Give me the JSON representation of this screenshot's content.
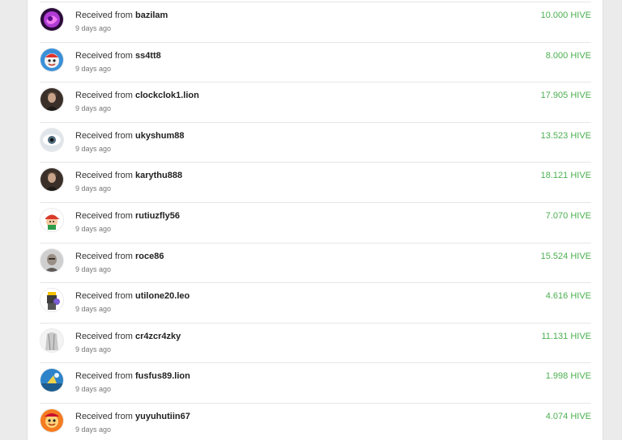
{
  "colors": {
    "amount": "#4caf50",
    "divider": "#e6e6e6"
  },
  "transfers": [
    {
      "prefix": "Received from",
      "user": "bazilam",
      "time": "9 days ago",
      "amount": "10.000 HIVE",
      "avatar_icon": "purple-graffiti-avatar-icon"
    },
    {
      "prefix": "Received from",
      "user": "ss4tt8",
      "time": "9 days ago",
      "amount": "8.000 HIVE",
      "avatar_icon": "cartoon-red-character-avatar-icon"
    },
    {
      "prefix": "Received from",
      "user": "clockclok1.lion",
      "time": "9 days ago",
      "amount": "17.905 HIVE",
      "avatar_icon": "portrait-photo-avatar-icon"
    },
    {
      "prefix": "Received from",
      "user": "ukyshum88",
      "time": "9 days ago",
      "amount": "13.523 HIVE",
      "avatar_icon": "eye-avatar-icon"
    },
    {
      "prefix": "Received from",
      "user": "karythu888",
      "time": "9 days ago",
      "amount": "18.121 HIVE",
      "avatar_icon": "portrait-photo-avatar-icon"
    },
    {
      "prefix": "Received from",
      "user": "rutiuzfly56",
      "time": "9 days ago",
      "amount": "7.070 HIVE",
      "avatar_icon": "cartoon-cap-character-avatar-icon"
    },
    {
      "prefix": "Received from",
      "user": "roce86",
      "time": "9 days ago",
      "amount": "15.524 HIVE",
      "avatar_icon": "grey-portrait-avatar-icon"
    },
    {
      "prefix": "Received from",
      "user": "utilone20.leo",
      "time": "9 days ago",
      "amount": "4.616 HIVE",
      "avatar_icon": "robot-character-avatar-icon"
    },
    {
      "prefix": "Received from",
      "user": "cr4zcr4zky",
      "time": "9 days ago",
      "amount": "11.131 HIVE",
      "avatar_icon": "pale-figure-avatar-icon"
    },
    {
      "prefix": "Received from",
      "user": "fusfus89.lion",
      "time": "9 days ago",
      "amount": "1.998 HIVE",
      "avatar_icon": "blue-scene-avatar-icon"
    },
    {
      "prefix": "Received from",
      "user": "yuyuhutiin67",
      "time": "9 days ago",
      "amount": "4.074 HIVE",
      "avatar_icon": "orange-character-avatar-icon"
    }
  ]
}
